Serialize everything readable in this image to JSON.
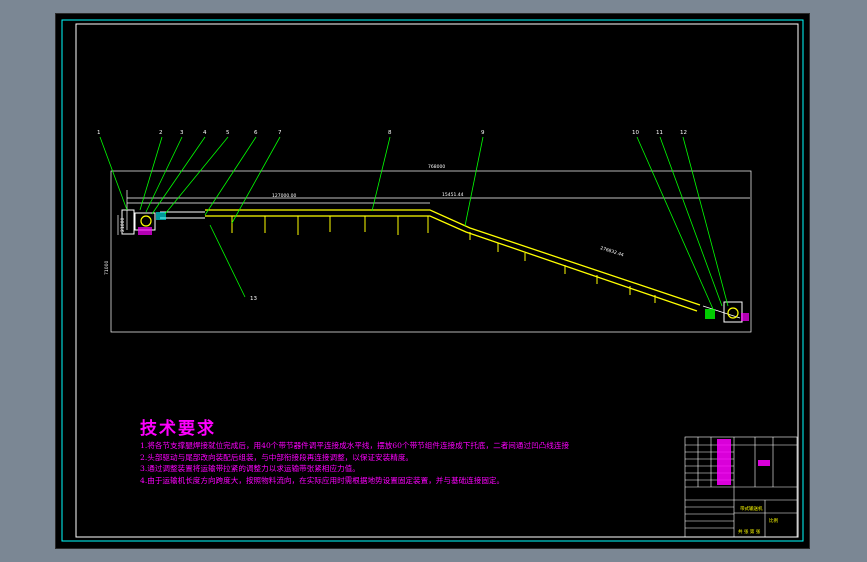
{
  "tech_requirements": {
    "title": "技术要求",
    "items": [
      "1.将各节支撑腿焊接就位完成后，用40个带节器件调平连接成水平线，摆放60个带节组件连接成下托底，二者间通过凹凸线连接",
      "2.头部驱动与尾部改向装配后组装，与中部衔接段再连接调整，以保证安装精度。",
      "3.通过调整装置将运输带拉紧的调整力以求运输带张紧相应力值。",
      "4.由于运输机长度方向跨度大，按照物料流向，在实际应用时需根据地势设置固定装置，并与基础连接固定。"
    ]
  },
  "callouts": [
    "1",
    "2",
    "3",
    "4",
    "5",
    "6",
    "7",
    "8",
    "9",
    "10",
    "11",
    "12",
    "13"
  ],
  "dimensions": {
    "total_length": "768000",
    "horizontal_section": "127000.00",
    "incline_start": "15451.44",
    "incline_length": "276832.44",
    "height": "71000",
    "left_height": "21000"
  },
  "title_block": {
    "drawing_title": "带式输送机",
    "scale_label": "比例",
    "sheet_label": "共 张 第 张"
  },
  "colors": {
    "background": "#000000",
    "frame": "#00ffff",
    "outline": "#ffffff",
    "conveyor": "#ffff00",
    "leaders": "#00ff00",
    "text": "#ff00ff"
  }
}
